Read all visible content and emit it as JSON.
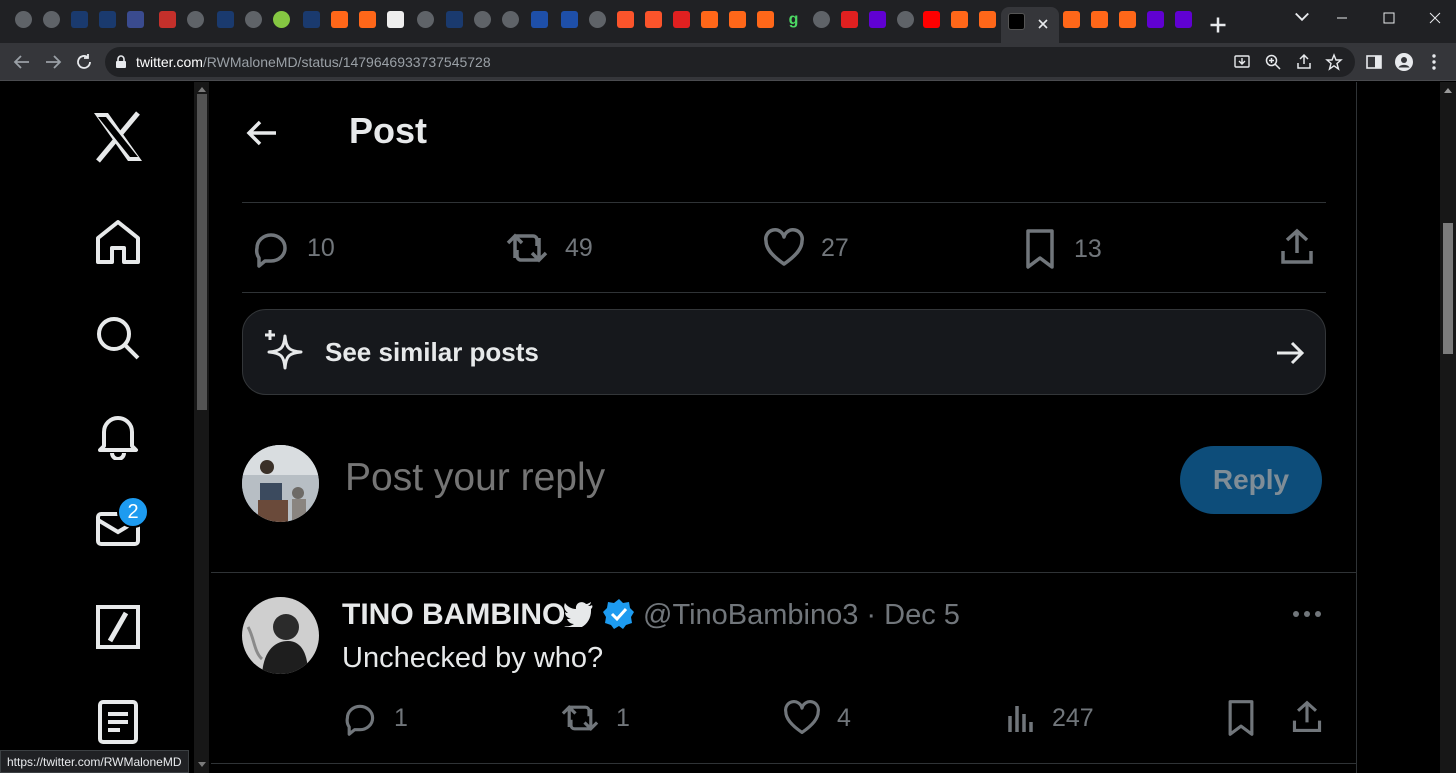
{
  "browser": {
    "url_host": "twitter.com",
    "url_path": "/RWMaloneMD/status/1479646933737545728",
    "status_bar_url": "https://twitter.com/RWMaloneMD"
  },
  "sidebar": {
    "messages_badge": "2"
  },
  "header": {
    "title": "Post"
  },
  "post_actions": {
    "replies": "10",
    "reposts": "49",
    "likes": "27",
    "bookmarks": "13"
  },
  "similar": {
    "label": "See similar posts"
  },
  "compose": {
    "placeholder": "Post your reply",
    "button_label": "Reply"
  },
  "reply": {
    "name": "TINO BAMBINO",
    "handle_time": "@TinoBambino3 · Dec 5",
    "text": "Unchecked by who?",
    "replies": "1",
    "reposts": "1",
    "likes": "4",
    "views": "247"
  },
  "colors": {
    "accent": "#1d9bf0",
    "muted": "#71767b",
    "reply_button": "#0d4d7a"
  }
}
